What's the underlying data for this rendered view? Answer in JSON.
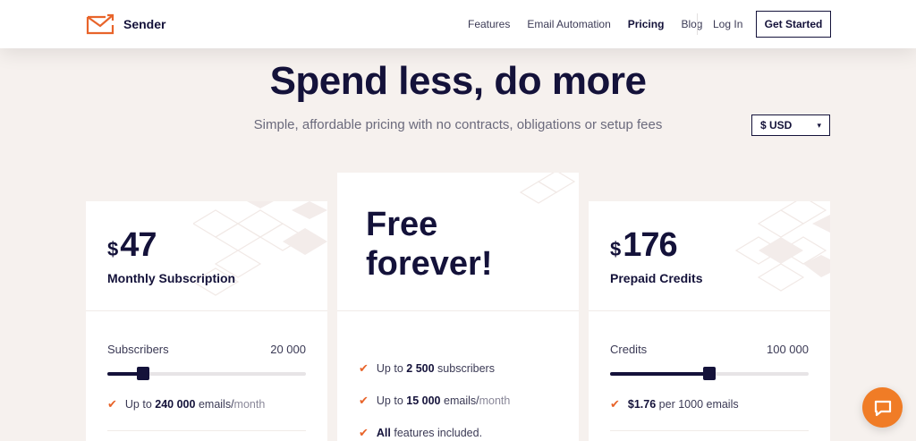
{
  "brand": {
    "name": "Sender",
    "accent": "#e8642a",
    "navy": "#14123a"
  },
  "nav": {
    "links": [
      "Features",
      "Email Automation",
      "Pricing",
      "Blog"
    ],
    "active": "Pricing",
    "login": "Log In",
    "cta": "Get Started"
  },
  "hero": {
    "title": "Spend less, do more",
    "subtitle": "Simple, affordable pricing with no contracts, obligations or setup fees",
    "currency": "$ USD"
  },
  "plans": {
    "monthly": {
      "currency_symbol": "$",
      "price": "47",
      "name": "Monthly Subscription",
      "slider_label": "Subscribers",
      "slider_value": "20 000",
      "slider_fraction": 0.18,
      "feature_prefix": "Up to",
      "feature_bold": "240 000",
      "feature_text": "emails/",
      "feature_muted": "month"
    },
    "free": {
      "title_line1": "Free",
      "title_line2": "forever!",
      "features": [
        {
          "prefix": "Up to",
          "bold": "2 500",
          "text": "subscribers",
          "muted": ""
        },
        {
          "prefix": "Up to",
          "bold": "15 000",
          "text": "emails/",
          "muted": "month"
        },
        {
          "prefix": "",
          "bold": "All",
          "text": "features included.",
          "muted": ""
        }
      ]
    },
    "prepaid": {
      "currency_symbol": "$",
      "price": "176",
      "name": "Prepaid Credits",
      "slider_label": "Credits",
      "slider_value": "100 000",
      "slider_fraction": 0.5,
      "feature_prefix": "",
      "feature_bold": "$1.76",
      "feature_text": "per 1000 emails",
      "feature_muted": ""
    }
  }
}
